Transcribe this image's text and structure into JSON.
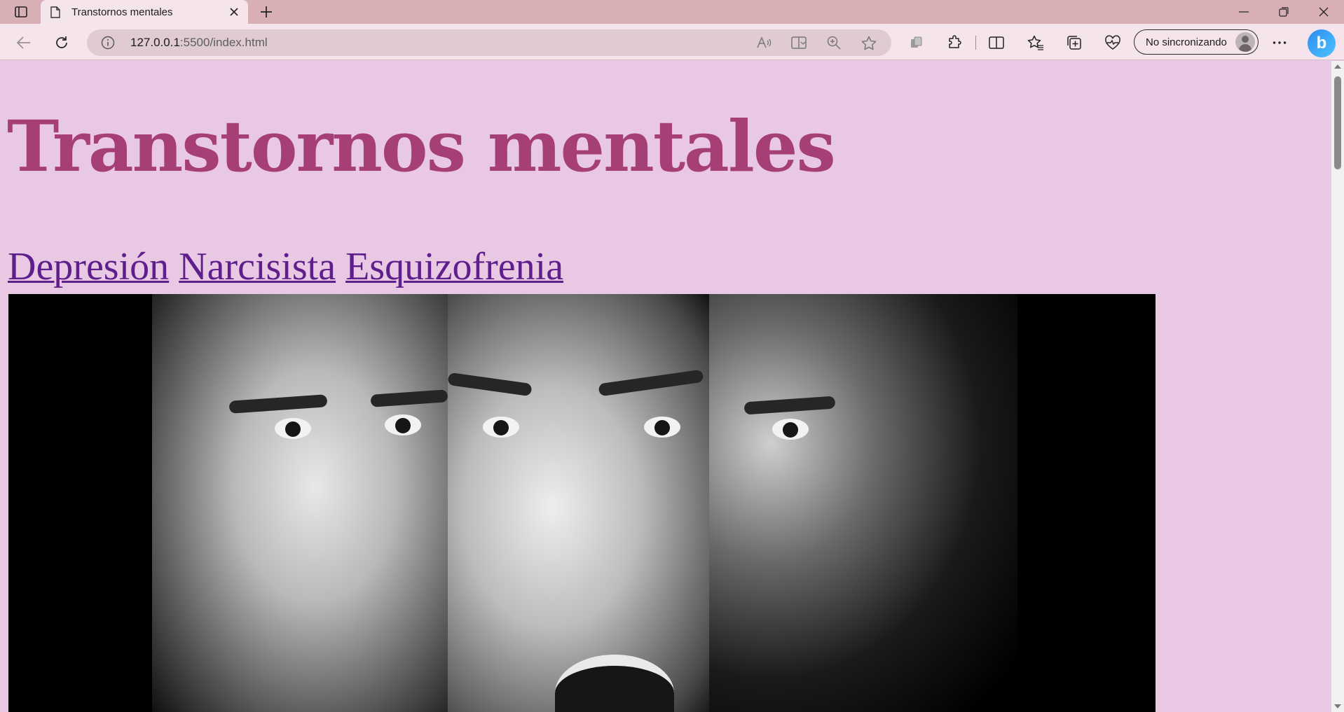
{
  "browser": {
    "tab": {
      "title": "Transtornos mentales"
    },
    "address": {
      "host": "127.0.0.1",
      "rest": ":5500/index.html"
    },
    "profile": {
      "label": "No sincronizando"
    },
    "icons": {
      "tab_actions": "tab-actions-icon",
      "page": "page-icon",
      "close_tab": "close-icon",
      "new_tab": "plus-icon",
      "minimize": "minimize-icon",
      "restore": "restore-icon",
      "close_window": "close-icon",
      "back": "arrow-left-icon",
      "refresh": "refresh-icon",
      "info": "info-icon",
      "read_aloud": "read-aloud-icon",
      "immersive_reader": "immersive-reader-icon",
      "zoom": "zoom-icon",
      "favorite": "star-icon",
      "extension_pack": "extension-pack-icon",
      "extensions": "puzzle-icon",
      "split_screen": "split-screen-icon",
      "favorites": "favorites-icon",
      "collections": "collections-icon",
      "browser_essentials": "heart-pulse-icon",
      "more": "ellipsis-icon",
      "copilot": "copilot-icon"
    }
  },
  "page": {
    "title": "Transtornos mentales",
    "nav_links": [
      "Depresión",
      "Narcisista",
      "Esquizofrenia"
    ]
  },
  "colors": {
    "page_background": "#e9c8e4",
    "title": "#a63f76",
    "link": "#5e1f8c",
    "browser_frame": "#d9afb6",
    "toolbar": "#f5e4ec"
  }
}
